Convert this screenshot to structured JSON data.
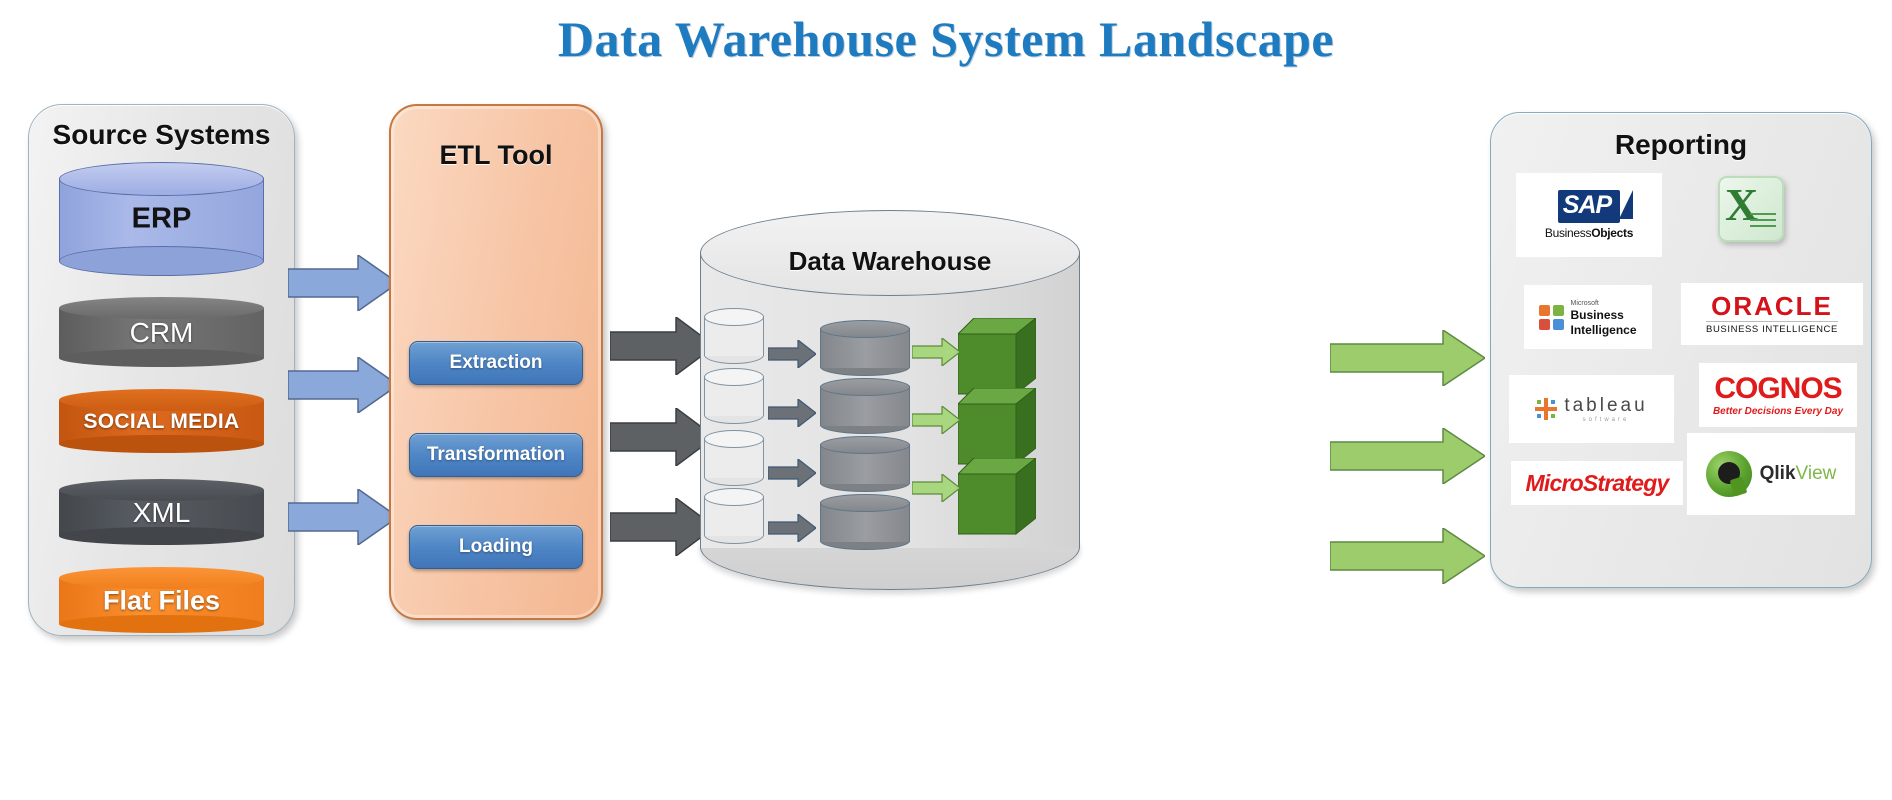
{
  "title": "Data Warehouse System Landscape",
  "source_systems": {
    "heading": "Source Systems",
    "items": [
      {
        "label": "ERP",
        "shape": "cylinder",
        "color": "#9fb0e0"
      },
      {
        "label": "CRM",
        "shape": "disc",
        "color": "#6e6e6e"
      },
      {
        "label": "SOCIAL MEDIA",
        "shape": "disc",
        "color": "#d4601a"
      },
      {
        "label": "XML",
        "shape": "disc",
        "color": "#4c5055"
      },
      {
        "label": "Flat Files",
        "shape": "disc",
        "color": "#f58220"
      }
    ]
  },
  "etl": {
    "heading": "ETL Tool",
    "steps": [
      "Extraction",
      "Transformation",
      "Loading"
    ],
    "panel_color": "#f7c6a7",
    "button_color": "#4f86c6"
  },
  "data_warehouse": {
    "heading": "Data Warehouse",
    "staging_cylinders": 4,
    "core_cylinders": 4,
    "cubes": 3
  },
  "reporting": {
    "heading": "Reporting",
    "tools": [
      {
        "name": "SAP Business Objects",
        "icon": "sap-logo"
      },
      {
        "name": "Microsoft Excel",
        "icon": "excel-logo"
      },
      {
        "name": "Microsoft Business Intelligence",
        "icon": "microsoft-bi-logo"
      },
      {
        "name": "Oracle Business Intelligence",
        "icon": "oracle-bi-logo"
      },
      {
        "name": "Tableau Software",
        "icon": "tableau-logo"
      },
      {
        "name": "Cognos",
        "icon": "cognos-logo"
      },
      {
        "name": "MicroStrategy",
        "icon": "microstrategy-logo"
      },
      {
        "name": "QlikView",
        "icon": "qlikview-logo"
      }
    ],
    "logo_text": {
      "sap_mark": "SAP",
      "sap_sub_light": "Business",
      "sap_sub_bold": "Objects",
      "excel_mark": "X",
      "msbi_vendor": "Microsoft",
      "msbi_line1": "Business",
      "msbi_line2": "Intelligence",
      "oracle_mark": "ORACLE",
      "oracle_sub": "BUSINESS INTELLIGENCE",
      "tableau_mark": "tableau",
      "tableau_sub": "software",
      "cognos_mark": "COGNOS",
      "cognos_sub": "Better Decisions Every Day",
      "microstrategy_mark": "MicroStrategy",
      "qlikview_mark": "Qlik",
      "qlikview_mark2": "View"
    }
  },
  "arrows": {
    "source_to_etl": {
      "count": 3,
      "color": "#89a9da",
      "name": "blue-arrow"
    },
    "etl_to_dw": {
      "count": 3,
      "color": "#5e6163",
      "name": "gray-arrow"
    },
    "dw_to_reporting": {
      "count": 3,
      "color": "#9ccc6b",
      "name": "green-arrow"
    }
  },
  "colors": {
    "title": "#1f7bbf",
    "panel_bg": "#e9e9e9",
    "cube_green": "#4b8b29"
  }
}
